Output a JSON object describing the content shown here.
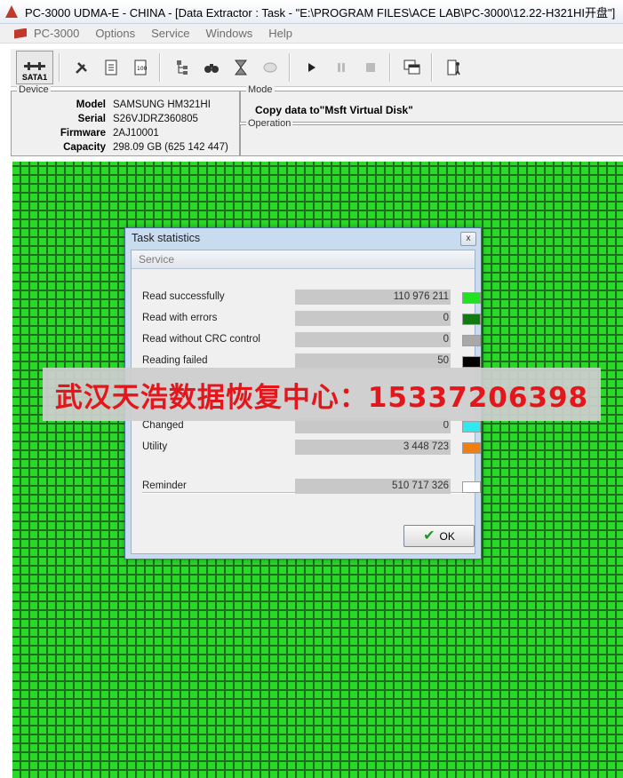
{
  "window": {
    "title": "PC-3000 UDMA-E - CHINA - [Data Extractor : Task - \"E:\\PROGRAM FILES\\ACE LAB\\PC-3000\\12.22-H321HI开盘\"]"
  },
  "menu": {
    "items": [
      "PC-3000",
      "Options",
      "Service",
      "Windows",
      "Help"
    ]
  },
  "toolbar": {
    "sata_label": "SATA1",
    "icons": [
      "port-icon",
      "tools-icon",
      "scroll-icon",
      "percent-doc-icon",
      "tree-icon",
      "binoculars-icon",
      "hourglass-icon",
      "disk-icon",
      "play-icon",
      "pause-icon",
      "stop-icon",
      "windows-icon",
      "exit-icon"
    ]
  },
  "device": {
    "title": "Device",
    "rows": [
      {
        "label": "Model",
        "value": "SAMSUNG HM321HI"
      },
      {
        "label": "Serial",
        "value": "S26VJDRZ360805"
      },
      {
        "label": "Firmware",
        "value": "2AJ10001"
      },
      {
        "label": "Capacity",
        "value": "298.09 GB (625 142 447)"
      }
    ]
  },
  "mode": {
    "title": "Mode",
    "text": "Copy data to\"Msft Virtual Disk\""
  },
  "operation": {
    "title": "Operation"
  },
  "dialog": {
    "title": "Task statistics",
    "close_label": "x",
    "section": "Service",
    "stats": [
      {
        "label": "Read successfully",
        "value": "110 976 211",
        "color": "#22e022"
      },
      {
        "label": "Read with errors",
        "value": "0",
        "color": "#137a13"
      },
      {
        "label": "Read without CRC control",
        "value": "0",
        "color": "#a8a8a8"
      },
      {
        "label": "Reading failed",
        "value": "50",
        "color": "#000000"
      },
      {
        "label": "Changed",
        "value": "0",
        "color": "#30e8f0"
      },
      {
        "label": "Utility",
        "value": "3 448 723",
        "color": "#f07f10"
      }
    ],
    "reminder": {
      "label": "Reminder",
      "value": "510 717 326",
      "color": "#ffffff"
    },
    "ok_label": "OK"
  },
  "watermark": {
    "text": "武汉天浩数据恢复中心：15337206398"
  }
}
